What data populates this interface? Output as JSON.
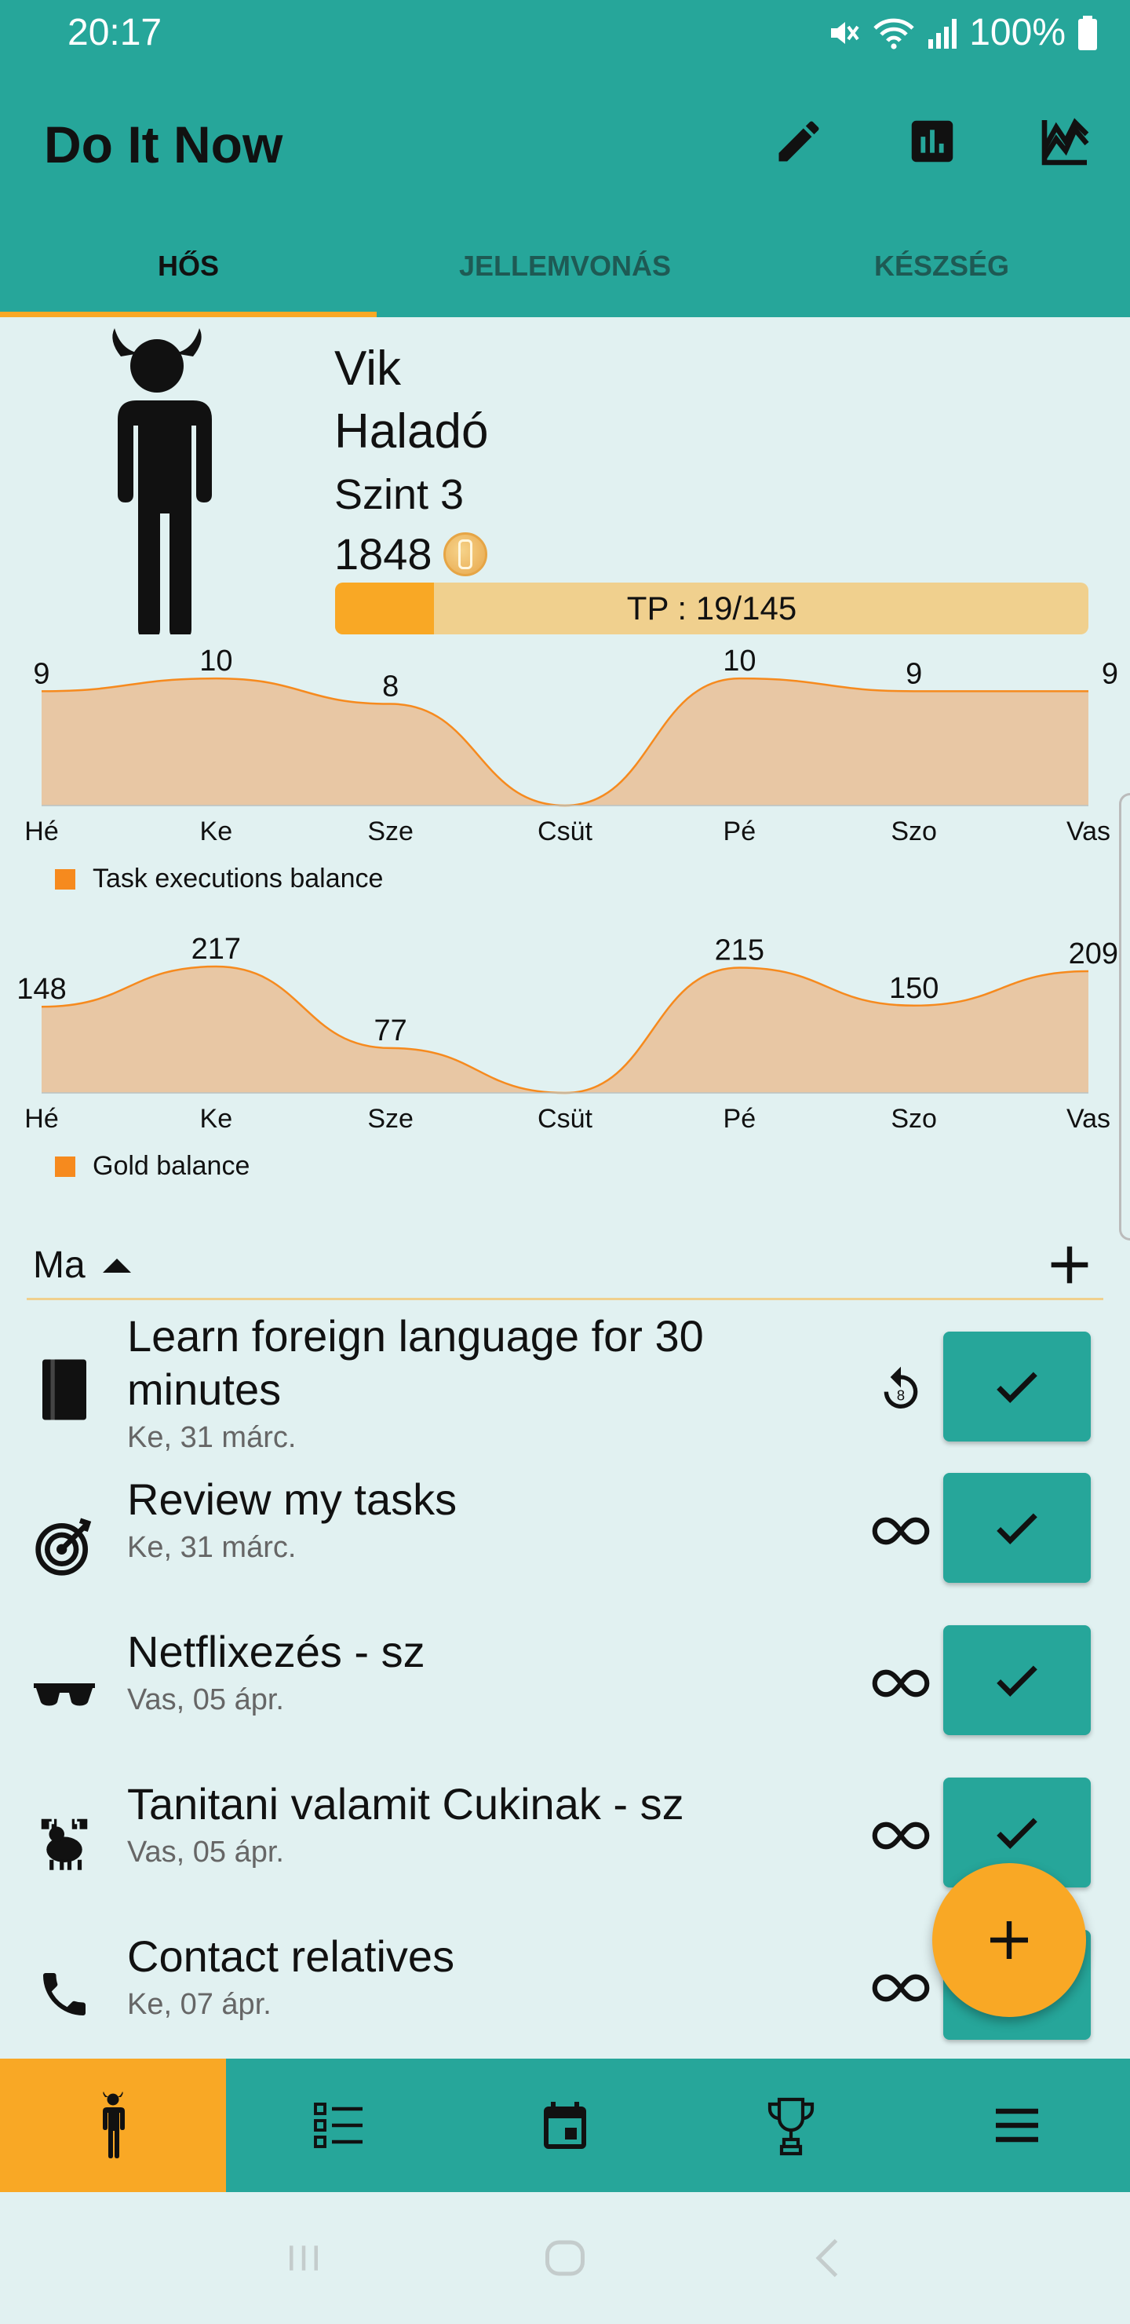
{
  "status": {
    "time": "20:17",
    "battery": "100%"
  },
  "app": {
    "title": "Do It Now"
  },
  "tabs": [
    {
      "label": "HŐS",
      "active": true
    },
    {
      "label": "JELLEMVONÁS",
      "active": false
    },
    {
      "label": "KÉSZSÉG",
      "active": false
    }
  ],
  "hero": {
    "name": "Vik",
    "rank": "Haladó",
    "level": "Szint 3",
    "gold": "1848",
    "tp_label": "TP : 19/145",
    "tp_current": 19,
    "tp_max": 145
  },
  "chart_data": [
    {
      "type": "area",
      "categories": [
        "Hé",
        "Ke",
        "Sze",
        "Csüt",
        "Pé",
        "Szo",
        "Vas"
      ],
      "series": [
        {
          "name": "Task executions balance",
          "values": [
            9,
            10,
            8,
            0,
            10,
            9,
            9
          ],
          "labels": [
            "9",
            "10",
            "8",
            "",
            "10",
            "9",
            "9"
          ]
        }
      ],
      "color": "#f68a1e",
      "fill": "#e8c7a4",
      "ylim": [
        0,
        11
      ],
      "legend": "bottom-left"
    },
    {
      "type": "area",
      "categories": [
        "Hé",
        "Ke",
        "Sze",
        "Csüt",
        "Pé",
        "Szo",
        "Vas"
      ],
      "series": [
        {
          "name": "Gold balance",
          "values": [
            148,
            217,
            77,
            0,
            215,
            150,
            209
          ],
          "labels": [
            "148",
            "217",
            "77",
            "",
            "215",
            "150",
            "209"
          ]
        }
      ],
      "color": "#f68a1e",
      "fill": "#e8c7a4",
      "ylim": [
        0,
        240
      ],
      "legend": "bottom-left"
    }
  ],
  "section": {
    "label": "Ma"
  },
  "tasks": [
    {
      "name": "Learn foreign language for 30 minutes",
      "date": "Ke, 31 márc.",
      "icon": "book-icon",
      "repeat": "replay-icon",
      "repeat_count": "8"
    },
    {
      "name": "Review my tasks",
      "date": "Ke, 31 márc.",
      "icon": "target-icon",
      "repeat": "infinity-icon"
    },
    {
      "name": "Netflixezés - sz",
      "date": "Vas, 05 ápr.",
      "icon": "sunglasses-icon",
      "repeat": "infinity-icon"
    },
    {
      "name": "Tanitani valamit Cukinak - sz",
      "date": "Vas, 05 ápr.",
      "icon": "moose-icon",
      "repeat": "infinity-icon"
    },
    {
      "name": "Contact relatives",
      "date": "Ke, 07 ápr.",
      "icon": "phone-icon",
      "repeat": "infinity-icon"
    }
  ],
  "bottom_nav": [
    {
      "icon": "hero-icon",
      "active": true
    },
    {
      "icon": "list-icon",
      "active": false
    },
    {
      "icon": "calendar-icon",
      "active": false
    },
    {
      "icon": "trophy-icon",
      "active": false
    },
    {
      "icon": "menu-icon",
      "active": false
    }
  ],
  "colors": {
    "primary": "#26a69a",
    "accent": "#f9a825",
    "background": "#e1f1f1",
    "chart_line": "#f68a1e",
    "chart_fill": "#e8c7a4"
  }
}
